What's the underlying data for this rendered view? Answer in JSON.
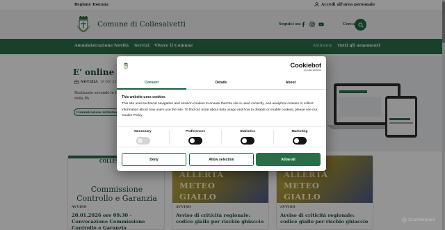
{
  "topbar": {
    "region": "Regione Toscana",
    "access": "Accedi all'area personale"
  },
  "header": {
    "title": "Comune di Collesalvetti",
    "social_label": "Seguici su:",
    "search_label": "Cerca"
  },
  "nav": {
    "items": [
      "Amministrazione",
      "Novità",
      "Servizi",
      "Vivere il Comune"
    ],
    "right_items": [
      "Ambiente",
      "Tutti gli argomenti"
    ]
  },
  "hero": {
    "category": "NOTIZIA",
    "date": "16 DIC 25",
    "title": "E' online il nu Comune di Co",
    "text": "Realizzato secondo le Lin della PA",
    "chip": "Comunicazione istituzionale"
  },
  "cards": [
    {
      "image_text_top": "COLLESALV",
      "image_text_1": "Commissione",
      "image_text_2": "Controllo e Garanzia",
      "tag": "AVVISO",
      "title": "20.01.2026 ore 09:30 - Convocazione Commissione Controllo e Garanzia"
    },
    {
      "image_text_1": "ALLERTA",
      "image_text_2": "METEO",
      "image_text_3": "GIALLO",
      "tag": "AVVISO",
      "title": "Avviso di criticità regionale: codice giallo per rischio ghiaccio"
    },
    {
      "image_text_1": "ALLERTA",
      "image_text_2": "METEO",
      "image_text_3": "GIALLO",
      "tag": "AVVISO",
      "title": "Avviso di criticità regionale: codice giallo per rischio ghiaccio"
    }
  ],
  "cookie": {
    "brand": "Cookiebot",
    "brand_by": "by Usercentrics",
    "tabs": [
      "Consent",
      "Details",
      "About"
    ],
    "heading": "This website uses cookies",
    "body": "This site uses technical navigation and session cookies to ensure that the site is used correctly, and analytical cookies to collect information about how users use the site. To find out more about data usage and how to disable or enable cookies, please see our Cookie Policy.",
    "toggles": [
      {
        "label": "Necessary",
        "state": "on-disabled"
      },
      {
        "label": "Preferences",
        "state": "off"
      },
      {
        "label": "Statistics",
        "state": "off"
      },
      {
        "label": "Marketing",
        "state": "off"
      }
    ],
    "buttons": {
      "deny": "Deny",
      "allow_selection": "Allow selection",
      "allow_all": "Allow all"
    }
  },
  "watermark": "ScanMalware",
  "colors": {
    "primary_green": "#2a6e49",
    "dark_green": "#1f4f3a",
    "meteo_yellow": "#c9b24a"
  }
}
